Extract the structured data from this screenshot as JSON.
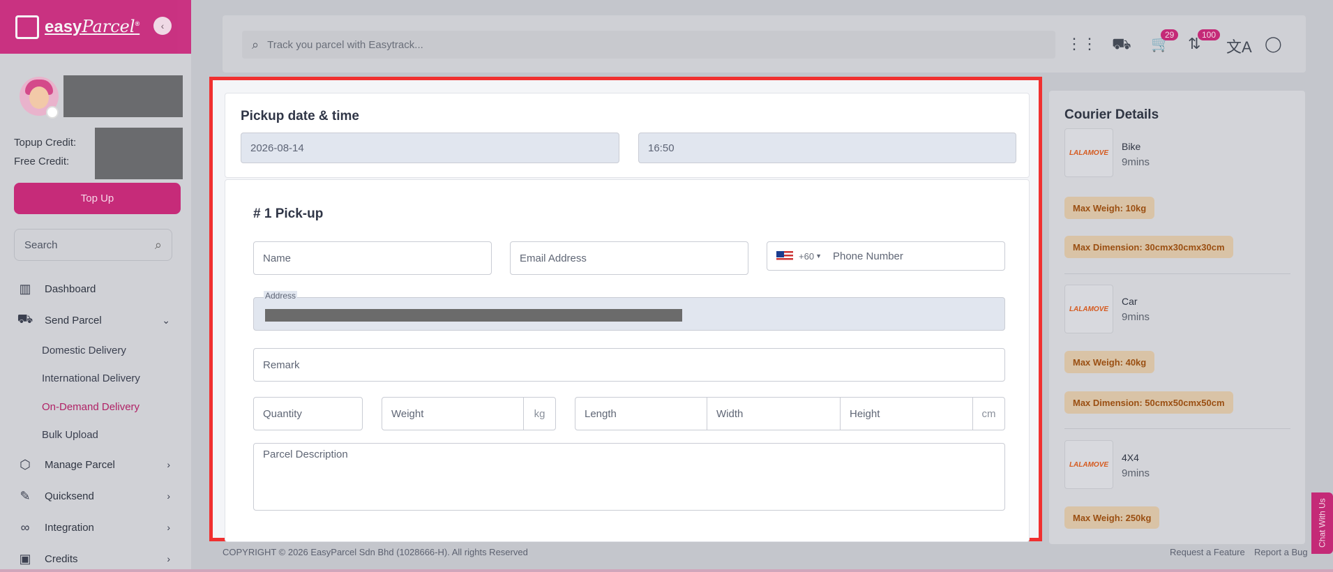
{
  "brand": {
    "name": "easy",
    "script": "Parcel",
    "mark": "®"
  },
  "sidebar": {
    "topup_credit_label": "Topup Credit:",
    "free_credit_label": "Free Credit:",
    "topup_button": "Top Up",
    "search_placeholder": "Search",
    "nav": [
      {
        "label": "Dashboard",
        "icon": "chart-icon"
      },
      {
        "label": "Send Parcel",
        "icon": "truck-icon"
      },
      {
        "label": "Manage Parcel",
        "icon": "box-icon"
      },
      {
        "label": "Quicksend",
        "icon": "edit-icon"
      },
      {
        "label": "Integration",
        "icon": "link-icon"
      },
      {
        "label": "Credits",
        "icon": "wallet-icon"
      }
    ],
    "sub": [
      {
        "label": "Domestic Delivery"
      },
      {
        "label": "International Delivery"
      },
      {
        "label": "On-Demand Delivery"
      },
      {
        "label": "Bulk Upload"
      }
    ]
  },
  "topbar": {
    "search_placeholder": "Track you parcel with Easytrack...",
    "cart_count": "29",
    "notif_count": "100"
  },
  "pickup_datetime": {
    "title": "Pickup date & time",
    "date": "2026-08-14",
    "time": "16:50"
  },
  "pickup": {
    "title": "# 1 Pick-up",
    "name_placeholder": "Name",
    "email_placeholder": "Email Address",
    "country_code": "+60",
    "phone_placeholder": "Phone Number",
    "address_label": "Address",
    "remark_placeholder": "Remark",
    "quantity_placeholder": "Quantity",
    "weight_placeholder": "Weight",
    "weight_unit": "kg",
    "length_placeholder": "Length",
    "width_placeholder": "Width",
    "height_placeholder": "Height",
    "dimension_unit": "cm",
    "description_placeholder": "Parcel Description"
  },
  "courier": {
    "title": "Courier Details",
    "logo_text": "LALAMOVE",
    "items": [
      {
        "name": "Bike",
        "time": "9mins",
        "weight": "Max Weigh: 10kg",
        "dimension": "Max Dimension: 30cmx30cmx30cm"
      },
      {
        "name": "Car",
        "time": "9mins",
        "weight": "Max Weigh: 40kg",
        "dimension": "Max Dimension: 50cmx50cmx50cm"
      },
      {
        "name": "4X4",
        "time": "9mins",
        "weight": "Max Weigh: 250kg"
      }
    ]
  },
  "footer": {
    "copyright": "COPYRIGHT © 2026 EasyParcel Sdn Bhd (1028666-H). All rights Reserved",
    "request_feature": "Request a Feature",
    "report_bug": "Report a Bug",
    "chat": "Chat With Us"
  },
  "colors": {
    "brand": "#c8106f",
    "highlight": "#f03030",
    "tag_bg": "#d9c3a6",
    "tag_text": "#9a4f12"
  }
}
